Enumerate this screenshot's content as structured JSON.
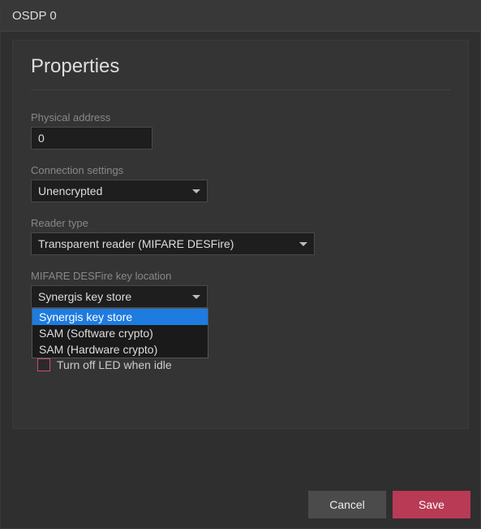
{
  "window": {
    "title": "OSDP 0"
  },
  "panel": {
    "title": "Properties"
  },
  "fields": {
    "physical_address": {
      "label": "Physical address",
      "value": "0"
    },
    "connection": {
      "label": "Connection settings",
      "value": "Unencrypted"
    },
    "reader_type": {
      "label": "Reader type",
      "value": "Transparent reader (MIFARE DESFire)"
    },
    "key_location": {
      "label": "MIFARE DESFire key location",
      "value": "Synergis key store",
      "options": [
        "Synergis key store",
        "SAM (Software crypto)",
        "SAM (Hardware crypto)"
      ]
    }
  },
  "checkbox": {
    "label": "Turn off LED when idle",
    "checked": false
  },
  "buttons": {
    "cancel": "Cancel",
    "save": "Save"
  }
}
